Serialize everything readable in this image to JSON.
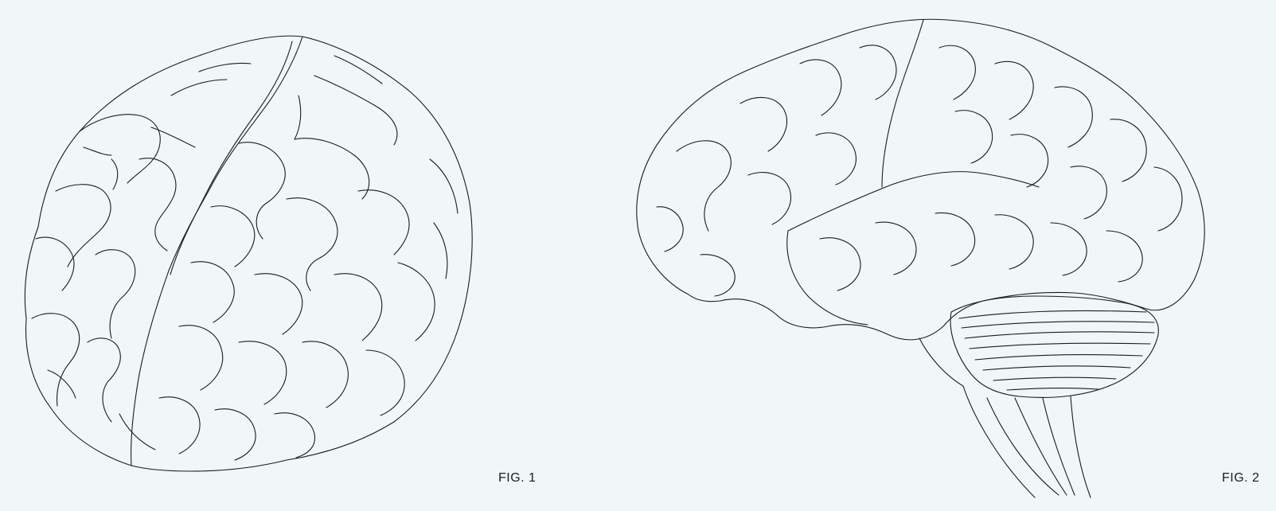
{
  "figures": [
    {
      "label": "FIG. 1"
    },
    {
      "label": "FIG. 2"
    }
  ]
}
